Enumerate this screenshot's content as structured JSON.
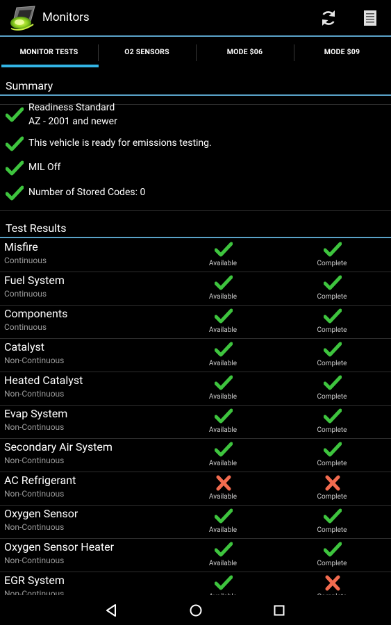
{
  "app": {
    "title": "Monitors"
  },
  "tabs": [
    {
      "label": "MONITOR TESTS",
      "selected": true
    },
    {
      "label": "O2 SENSORS",
      "selected": false
    },
    {
      "label": "MODE $06",
      "selected": false
    },
    {
      "label": "MODE $09",
      "selected": false
    }
  ],
  "summary": {
    "header": "Summary",
    "items": [
      {
        "line1": "Readiness Standard",
        "line2": "AZ - 2001 and newer"
      },
      {
        "line1": "This vehicle is ready for emissions testing."
      },
      {
        "line1": "MIL Off"
      },
      {
        "line1": "Number of Stored Codes: 0"
      }
    ]
  },
  "results": {
    "header": "Test Results",
    "rows": [
      {
        "name": "Misfire",
        "type": "Continuous",
        "available": "Available",
        "available_ok": true,
        "complete": "Complete",
        "complete_ok": true
      },
      {
        "name": "Fuel System",
        "type": "Continuous",
        "available": "Available",
        "available_ok": true,
        "complete": "Complete",
        "complete_ok": true
      },
      {
        "name": "Components",
        "type": "Continuous",
        "available": "Available",
        "available_ok": true,
        "complete": "Complete",
        "complete_ok": true
      },
      {
        "name": "Catalyst",
        "type": "Non-Continuous",
        "available": "Available",
        "available_ok": true,
        "complete": "Complete",
        "complete_ok": true
      },
      {
        "name": "Heated Catalyst",
        "type": "Non-Continuous",
        "available": "Available",
        "available_ok": true,
        "complete": "Complete",
        "complete_ok": true
      },
      {
        "name": "Evap System",
        "type": "Non-Continuous",
        "available": "Available",
        "available_ok": true,
        "complete": "Complete",
        "complete_ok": true
      },
      {
        "name": "Secondary Air System",
        "type": "Non-Continuous",
        "available": "Available",
        "available_ok": true,
        "complete": "Complete",
        "complete_ok": true
      },
      {
        "name": "AC Refrigerant",
        "type": "Non-Continuous",
        "available": "Available",
        "available_ok": false,
        "complete": "Complete",
        "complete_ok": false
      },
      {
        "name": "Oxygen Sensor",
        "type": "Non-Continuous",
        "available": "Available",
        "available_ok": true,
        "complete": "Complete",
        "complete_ok": true
      },
      {
        "name": "Oxygen Sensor Heater",
        "type": "Non-Continuous",
        "available": "Available",
        "available_ok": true,
        "complete": "Complete",
        "complete_ok": true
      },
      {
        "name": "EGR System",
        "type": "Non-Continuous",
        "available": "Available",
        "available_ok": true,
        "complete": "Complete",
        "complete_ok": false
      }
    ]
  },
  "colors": {
    "ok": "#3ec43e",
    "fail": "#f26b4f",
    "accent": "#33b5e5",
    "rule": "#5aa2c8"
  },
  "icons": {
    "app": "obd-car-logo-icon",
    "refresh": "refresh-icon",
    "menu": "document-menu-icon",
    "ok": "check-mark-icon",
    "fail": "cross-mark-icon",
    "nav_back": "back-triangle-icon",
    "nav_home": "home-circle-icon",
    "nav_recents": "recents-square-icon"
  }
}
